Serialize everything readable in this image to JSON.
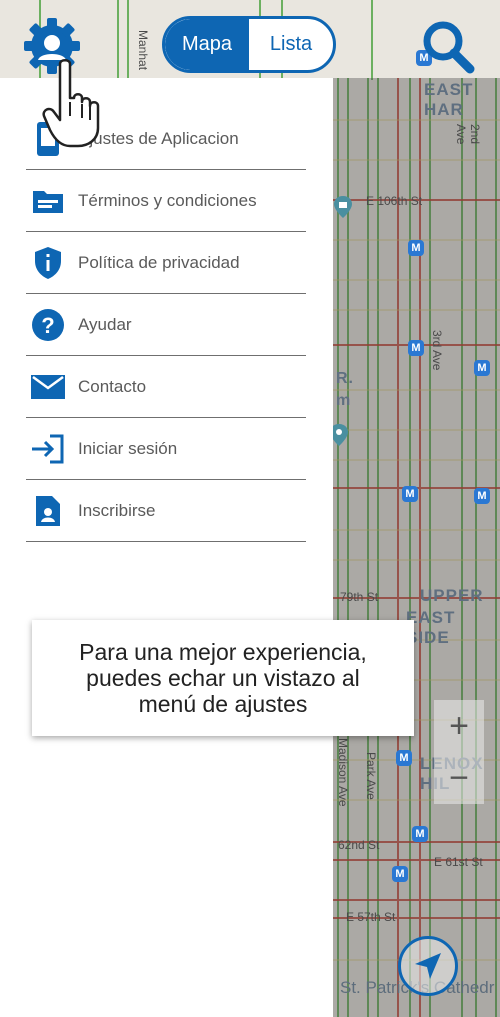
{
  "toggle": {
    "map_label": "Mapa",
    "list_label": "Lista"
  },
  "menu": {
    "items": [
      {
        "label": "Ajustes de Aplicacion",
        "icon": "phone-settings-icon"
      },
      {
        "label": "Términos y condiciones",
        "icon": "folder-icon"
      },
      {
        "label": "Política de privacidad",
        "icon": "shield-info-icon"
      },
      {
        "label": "Ayudar",
        "icon": "help-circle-icon"
      },
      {
        "label": "Contacto",
        "icon": "mail-icon"
      },
      {
        "label": "Iniciar sesión",
        "icon": "login-icon"
      },
      {
        "label": "Inscribirse",
        "icon": "signup-document-icon"
      }
    ]
  },
  "tooltip": {
    "line1": "Para una mejor experiencia,",
    "line2": "puedes echar un vistazo al",
    "line3": "menú de ajustes"
  },
  "map": {
    "labels": {
      "east_harlem": "EAST HAR",
      "upper": "UPPER",
      "east_side": "EAST SIDE",
      "lenox_hill": "LENOX HIL",
      "r": "R.",
      "m": "m",
      "st_patrick": "St. Patrick's Cathedr",
      "manhattan": "Manhat",
      "e106": "E 106th St",
      "e79": "79th St",
      "e62": "62nd St",
      "e61": "E 61st St",
      "e57": "E 57th St",
      "second_ave": "2nd Ave",
      "third_ave": "3rd Ave",
      "park_ave": "Park Ave",
      "madison": "Madison Ave"
    }
  },
  "zoom": {
    "in": "+",
    "out": "−"
  },
  "colors": {
    "brand_blue": "#0e66b3",
    "metro_blue": "#2a78d3"
  }
}
